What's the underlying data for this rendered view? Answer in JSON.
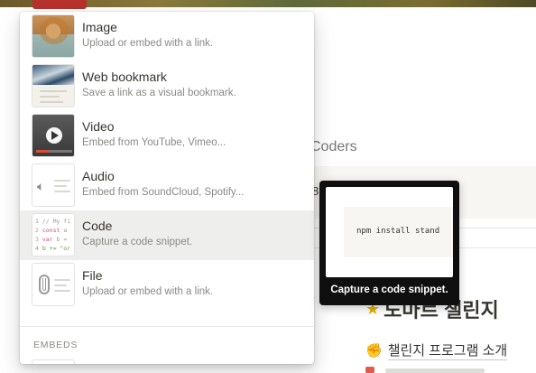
{
  "menu": {
    "items": [
      {
        "title": "Image",
        "desc": "Upload or embed with a link."
      },
      {
        "title": "Web bookmark",
        "desc": "Save a link as a visual bookmark."
      },
      {
        "title": "Video",
        "desc": "Embed from YouTube, Vimeo..."
      },
      {
        "title": "Audio",
        "desc": "Embed from SoundCloud, Spotify..."
      },
      {
        "title": "Code",
        "desc": "Capture a code snippet."
      },
      {
        "title": "File",
        "desc": "Upload or embed with a link."
      }
    ],
    "selected_index": 4,
    "section_label": "EMBEDS"
  },
  "tooltip": {
    "caption": "Capture a code snippet.",
    "preview_code": "npm install stand"
  },
  "page": {
    "heading_partial": "Coders",
    "band_partial": "8",
    "h1": "도마르 챌린지",
    "link": "챌린지 프로그램 소개"
  },
  "code_thumb": {
    "line1": "1 // My fi",
    "line2_kw": "const",
    "line2_rest": " a",
    "line3_kw": "var",
    "line3_rest": " b =",
    "line4": "b += \"or"
  },
  "colors": {
    "selected_row": "#eeeeec",
    "tooltip_bg": "#0f0f0f",
    "text": "#37352f",
    "muted": "#8a8985"
  }
}
